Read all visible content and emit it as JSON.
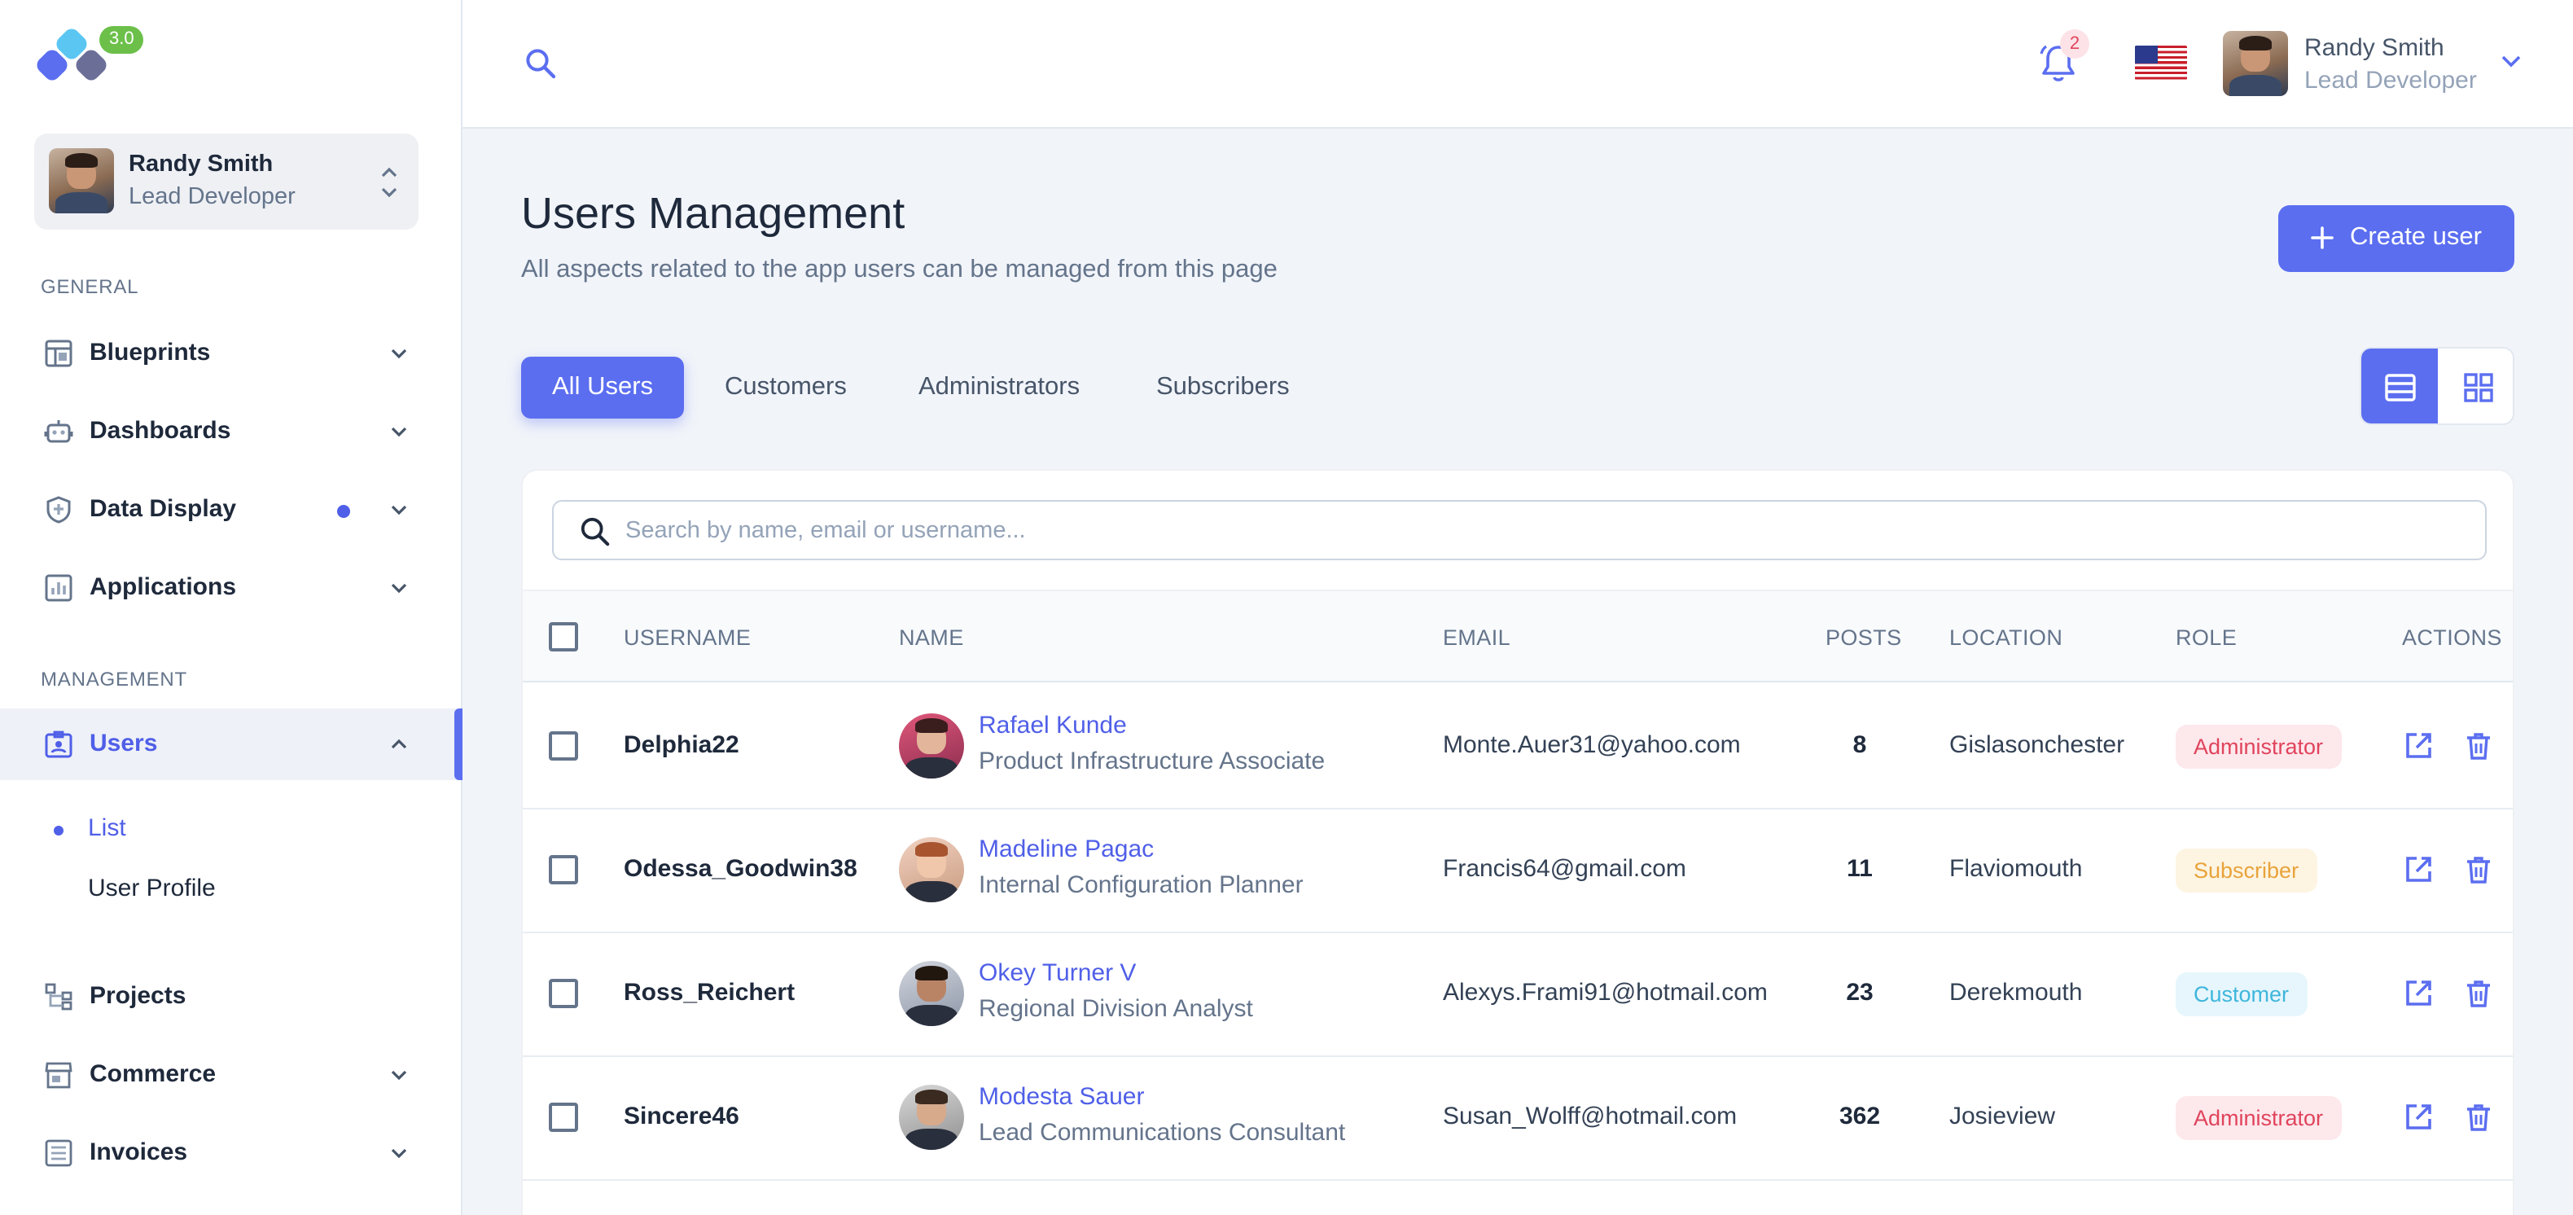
{
  "app": {
    "version_badge": "3.0"
  },
  "sidebar": {
    "user": {
      "name": "Randy Smith",
      "role": "Lead Developer"
    },
    "general_label": "GENERAL",
    "general_items": [
      {
        "label": "Blueprints",
        "icon": "layout-icon"
      },
      {
        "label": "Dashboards",
        "icon": "robot-icon"
      },
      {
        "label": "Data Display",
        "icon": "shield-icon",
        "has_dot": true
      },
      {
        "label": "Applications",
        "icon": "chart-box-icon"
      }
    ],
    "management_label": "MANAGEMENT",
    "users_item": {
      "label": "Users",
      "icon": "id-badge-icon"
    },
    "users_sub": [
      {
        "label": "List"
      },
      {
        "label": "User Profile"
      }
    ],
    "other_items": [
      {
        "label": "Projects",
        "icon": "hierarchy-icon"
      },
      {
        "label": "Commerce",
        "icon": "store-icon"
      },
      {
        "label": "Invoices",
        "icon": "list-doc-icon"
      }
    ]
  },
  "topbar": {
    "notification_count": "2",
    "user": {
      "name": "Randy Smith",
      "role": "Lead Developer"
    }
  },
  "page": {
    "title": "Users Management",
    "subtitle": "All aspects related to the app users can be managed from this page",
    "create_button": "Create user"
  },
  "tabs": [
    {
      "label": "All Users",
      "active": true
    },
    {
      "label": "Customers"
    },
    {
      "label": "Administrators"
    },
    {
      "label": "Subscribers"
    }
  ],
  "search": {
    "placeholder": "Search by name, email or username..."
  },
  "table": {
    "headers": {
      "username": "USERNAME",
      "name": "NAME",
      "email": "EMAIL",
      "posts": "POSTS",
      "location": "LOCATION",
      "role": "ROLE",
      "actions": "ACTIONS"
    },
    "rows": [
      {
        "username": "Delphia22",
        "name": "Rafael Kunde",
        "job": "Product Infrastructure Associate",
        "email": "Monte.Auer31@yahoo.com",
        "posts": "8",
        "location": "Gislasonchester",
        "role": "Administrator"
      },
      {
        "username": "Odessa_Goodwin38",
        "name": "Madeline Pagac",
        "job": "Internal Configuration Planner",
        "email": "Francis64@gmail.com",
        "posts": "11",
        "location": "Flaviomouth",
        "role": "Subscriber"
      },
      {
        "username": "Ross_Reichert",
        "name": "Okey Turner V",
        "job": "Regional Division Analyst",
        "email": "Alexys.Frami91@hotmail.com",
        "posts": "23",
        "location": "Derekmouth",
        "role": "Customer"
      },
      {
        "username": "Sincere46",
        "name": "Modesta Sauer",
        "job": "Lead Communications Consultant",
        "email": "Susan_Wolff@hotmail.com",
        "posts": "362",
        "location": "Josieview",
        "role": "Administrator"
      }
    ]
  },
  "colors": {
    "accent": "#5b6ef0",
    "administrator_bg": "#fde8ec",
    "administrator_fg": "#e0445c",
    "subscriber_bg": "#fef4e2",
    "subscriber_fg": "#e8a33a",
    "customer_bg": "#e6f6fc",
    "customer_fg": "#3fb6dc"
  }
}
